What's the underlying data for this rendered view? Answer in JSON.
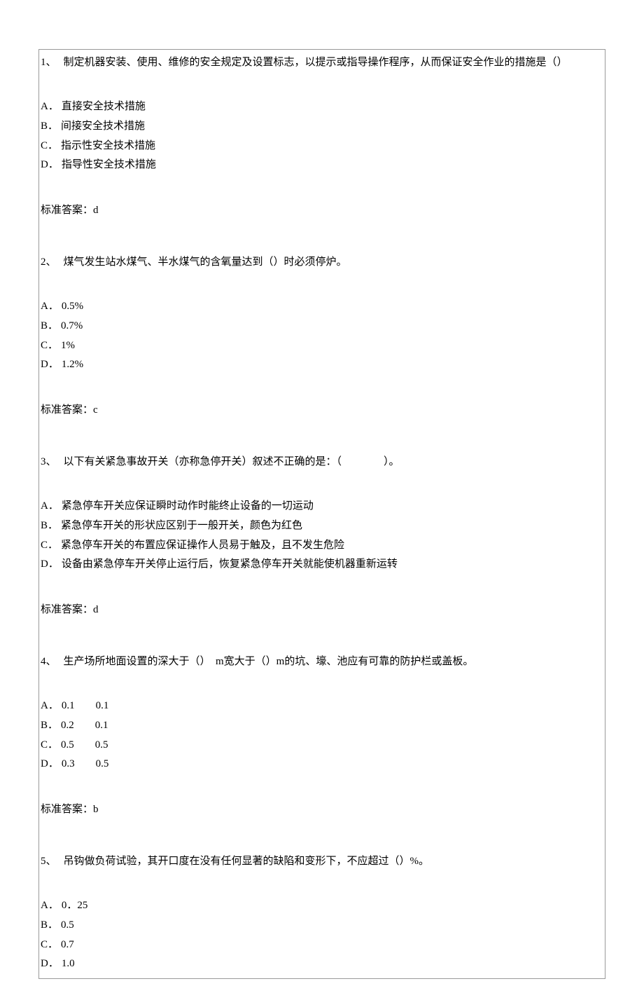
{
  "questions": [
    {
      "num": "1、",
      "text": "制定机器安装、使用、维修的安全规定及设置标志，以提示或指导操作程序，从而保证安全作业的措施是（）",
      "options": [
        {
          "letter": "A．",
          "text": "直接安全技术措施"
        },
        {
          "letter": "B．",
          "text": "间接安全技术措施"
        },
        {
          "letter": "C．",
          "text": "指示性安全技术措施"
        },
        {
          "letter": "D．",
          "text": "指导性安全技术措施"
        }
      ],
      "answer_label": "标准答案：",
      "answer_value": "d"
    },
    {
      "num": "2、",
      "text": "煤气发生站水煤气、半水煤气的含氧量达到（）时必须停炉。",
      "options": [
        {
          "letter": "A．",
          "text": "0.5%"
        },
        {
          "letter": "B．",
          "text": "0.7%"
        },
        {
          "letter": "C．",
          "text": "1%"
        },
        {
          "letter": "D．",
          "text": "1.2%"
        }
      ],
      "answer_label": "标准答案：",
      "answer_value": "c"
    },
    {
      "num": "3、",
      "text": "以下有关紧急事故开关（亦称急停开关）叙述不正确的是：（　　　　）。",
      "options": [
        {
          "letter": "A．",
          "text": "紧急停车开关应保证瞬时动作时能终止设备的一切运动"
        },
        {
          "letter": "B．",
          "text": "紧急停车开关的形状应区别于一般开关，颜色为红色"
        },
        {
          "letter": "C．",
          "text": "紧急停车开关的布置应保证操作人员易于触及，且不发生危险"
        },
        {
          "letter": "D．",
          "text": "设备由紧急停车开关停止运行后，恢复紧急停车开关就能使机器重新运转"
        }
      ],
      "answer_label": "标准答案：",
      "answer_value": "d"
    },
    {
      "num": "4、",
      "text": "生产场所地面设置的深大于（）  m宽大于（）m的坑、壕、池应有可靠的防护栏或盖板。",
      "options": [
        {
          "letter": "A．",
          "text": "0.1　　0.1"
        },
        {
          "letter": "B．",
          "text": "0.2　　0.1"
        },
        {
          "letter": "C．",
          "text": "0.5　　0.5"
        },
        {
          "letter": "D．",
          "text": "0.3　　0.5"
        }
      ],
      "answer_label": "标准答案：",
      "answer_value": "b"
    },
    {
      "num": "5、",
      "text": "吊钩做负荷试验，其开口度在没有任何显著的缺陷和变形下，不应超过（）%。",
      "options": [
        {
          "letter": "A．",
          "text": "0．25"
        },
        {
          "letter": "B．",
          "text": "0.5"
        },
        {
          "letter": "C．",
          "text": "0.7"
        },
        {
          "letter": "D．",
          "text": "1.0"
        }
      ],
      "answer_label": "",
      "answer_value": ""
    }
  ]
}
